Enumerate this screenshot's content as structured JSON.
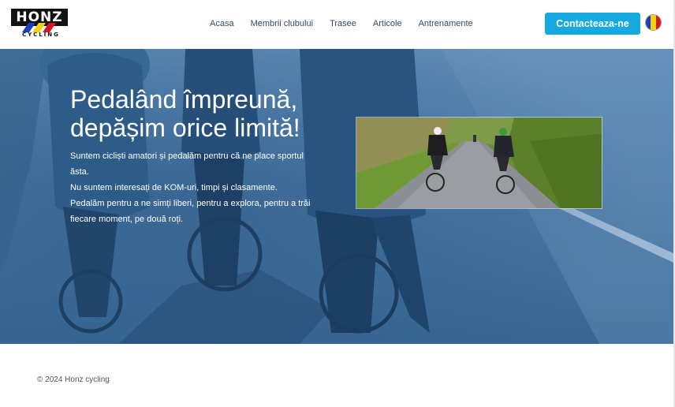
{
  "brand": {
    "logo_main": "HONZ",
    "logo_sub": "CYCLING",
    "logo_colors": [
      "#1a3fb8",
      "#f5d10b",
      "#d5171e"
    ]
  },
  "nav": {
    "items": [
      {
        "label": "Acasa"
      },
      {
        "label": "Membrii clubului"
      },
      {
        "label": "Trasee"
      },
      {
        "label": "Articole"
      },
      {
        "label": "Antrenamente"
      }
    ]
  },
  "header": {
    "cta_label": "Contacteaza-ne",
    "language_flag": "romania-flag-icon"
  },
  "hero": {
    "title_line1": "Pedalând împreună,",
    "title_line2": "depășim orice limită!",
    "paragraph_1": "Suntem cicliști amatori și pedalăm pentru că ne place sportul ăsta.",
    "paragraph_2": "Nu suntem interesați de KOM-uri, timpi și clasamente.",
    "paragraph_3": "Pedalăm pentru a ne simți liberi, pentru a explora, pentru a trăi fiecare moment, pe două roți."
  },
  "colors": {
    "accent": "#16a9e0",
    "nav_text": "#334a66",
    "hero_overlay": "#3f6d9a"
  },
  "footer": {
    "copyright": "© 2024 Honz cycling"
  }
}
